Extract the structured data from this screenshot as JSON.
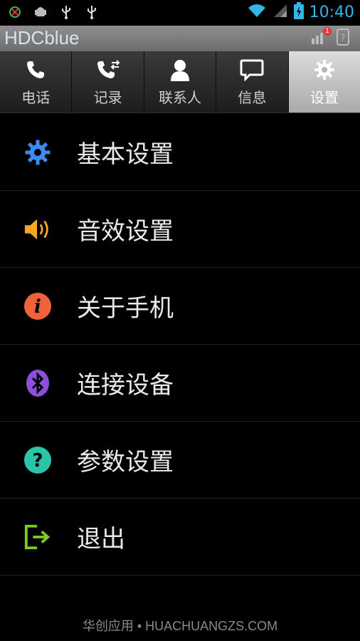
{
  "statusbar": {
    "icons_left": [
      "xbox-icon",
      "android-debug-icon",
      "usb-icon",
      "usb-icon"
    ],
    "icons_right": [
      "wifi-icon",
      "signal-icon",
      "battery-charging-icon"
    ],
    "time": "10:40",
    "accent": "#33b5e5"
  },
  "app": {
    "title": "HDCblue",
    "badge_count": "1"
  },
  "tabs": [
    {
      "label": "电话",
      "icon": "phone-icon"
    },
    {
      "label": "记录",
      "icon": "call-log-icon"
    },
    {
      "label": "联系人",
      "icon": "contact-icon"
    },
    {
      "label": "信息",
      "icon": "message-icon"
    },
    {
      "label": "设置",
      "icon": "gear-icon",
      "active": true
    }
  ],
  "menu": [
    {
      "label": "基本设置",
      "icon": "gear-icon",
      "color": "#3d8bf2"
    },
    {
      "label": "音效设置",
      "icon": "speaker-icon",
      "color": "#f5a623"
    },
    {
      "label": "关于手机",
      "icon": "info-icon",
      "color": "#f0623a"
    },
    {
      "label": "连接设备",
      "icon": "bluetooth-icon",
      "color": "#8c4fd9"
    },
    {
      "label": "参数设置",
      "icon": "help-icon",
      "color": "#2bc4a8"
    },
    {
      "label": "退出",
      "icon": "exit-icon",
      "color": "#7dcc1e"
    }
  ],
  "footer": "华创应用 • HUACHUANGZS.COM"
}
